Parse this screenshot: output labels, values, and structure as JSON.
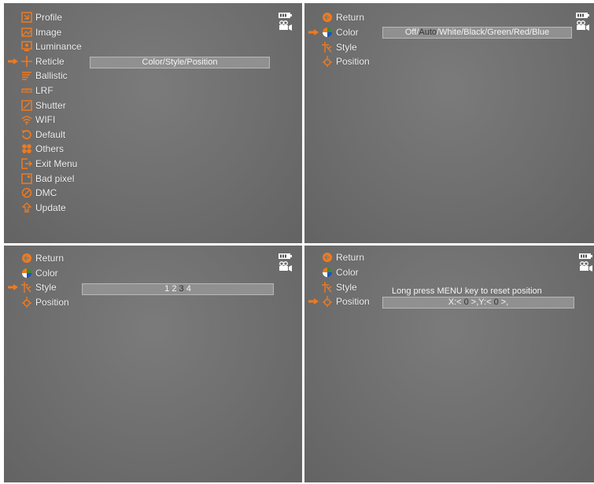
{
  "panel1": {
    "items": [
      {
        "label": "Profile",
        "icon": "profile-icon"
      },
      {
        "label": "Image",
        "icon": "image-icon"
      },
      {
        "label": "Luminance",
        "icon": "luminance-icon"
      },
      {
        "label": "Reticle",
        "icon": "reticle-icon"
      },
      {
        "label": "Ballistic",
        "icon": "ballistic-icon"
      },
      {
        "label": "LRF",
        "icon": "lrf-icon"
      },
      {
        "label": "Shutter",
        "icon": "shutter-icon"
      },
      {
        "label": "WIFI",
        "icon": "wifi-icon"
      },
      {
        "label": "Default",
        "icon": "default-icon"
      },
      {
        "label": "Others",
        "icon": "others-icon"
      },
      {
        "label": "Exit Menu",
        "icon": "exit-icon"
      },
      {
        "label": "Bad pixel",
        "icon": "bad-pixel-icon"
      },
      {
        "label": "DMC",
        "icon": "dmc-icon"
      },
      {
        "label": "Update",
        "icon": "update-icon"
      }
    ],
    "selected_index": 3,
    "bar_text": "Color/Style/Position"
  },
  "panel2": {
    "items": [
      {
        "label": "Return",
        "icon": "return-icon"
      },
      {
        "label": "Color",
        "icon": "color-icon"
      },
      {
        "label": "Style",
        "icon": "style-icon"
      },
      {
        "label": "Position",
        "icon": "position-icon"
      }
    ],
    "selected_index": 1,
    "bar": {
      "before": "Off/",
      "highlight": "Auto",
      "after": "/White/Black/Green/Red/Blue"
    }
  },
  "panel3": {
    "items": [
      {
        "label": "Return",
        "icon": "return-icon"
      },
      {
        "label": "Color",
        "icon": "color-icon"
      },
      {
        "label": "Style",
        "icon": "style-icon"
      },
      {
        "label": "Position",
        "icon": "position-icon"
      }
    ],
    "selected_index": 2,
    "bar": {
      "before": "1 2 ",
      "highlight": "3",
      "after": " 4"
    }
  },
  "panel4": {
    "items": [
      {
        "label": "Return",
        "icon": "return-icon"
      },
      {
        "label": "Color",
        "icon": "color-icon"
      },
      {
        "label": "Style",
        "icon": "style-icon"
      },
      {
        "label": "Position",
        "icon": "position-icon"
      }
    ],
    "selected_index": 3,
    "hint": "Long press MENU key to reset position",
    "bar": {
      "x_label": "X:< ",
      "x_value": "0",
      "mid": " >,Y:< ",
      "y_value": "0",
      "after": " >,"
    }
  },
  "colors": {
    "accent": "#f07a1e",
    "bar_bg": "#909090",
    "highlight_text": "#333333"
  },
  "status_icons": [
    "battery-icon",
    "video-record-icon"
  ]
}
